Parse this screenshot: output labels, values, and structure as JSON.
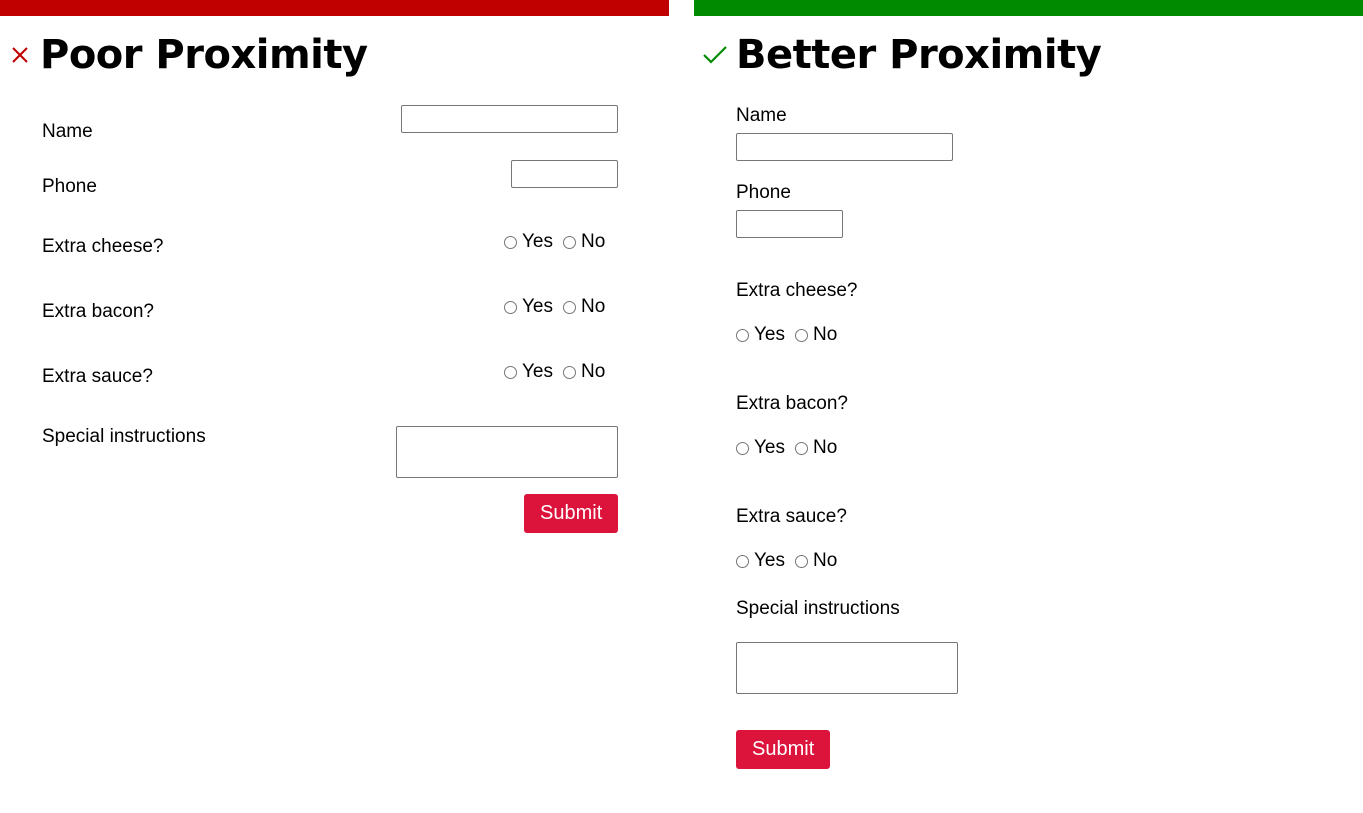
{
  "colors": {
    "poor_bar": "#c00000",
    "better_bar": "#008a00",
    "poor_mark": "#c00000",
    "better_mark": "#008a00",
    "submit_bg": "#dc143c"
  },
  "poor": {
    "title": "Poor Proximity",
    "icon": "x-icon",
    "fields": {
      "name_label": "Name",
      "phone_label": "Phone",
      "cheese_label": "Extra cheese?",
      "bacon_label": "Extra bacon?",
      "sauce_label": "Extra sauce?",
      "instructions_label": "Special instructions",
      "yes": "Yes",
      "no": "No"
    },
    "submit_label": "Submit"
  },
  "better": {
    "title": "Better Proximity",
    "icon": "check-icon",
    "fields": {
      "name_label": "Name",
      "phone_label": "Phone",
      "cheese_label": "Extra cheese?",
      "bacon_label": "Extra bacon?",
      "sauce_label": "Extra sauce?",
      "instructions_label": "Special instructions",
      "yes": "Yes",
      "no": "No"
    },
    "submit_label": "Submit"
  }
}
